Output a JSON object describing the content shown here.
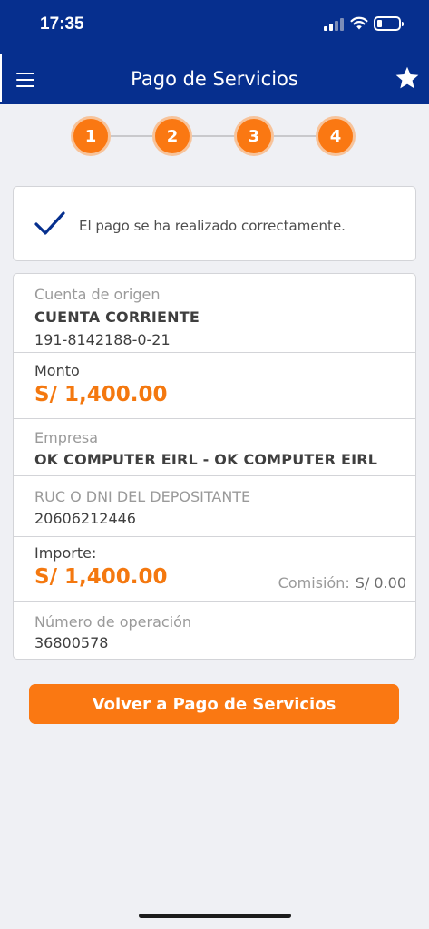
{
  "status_bar": {
    "time": "17:35"
  },
  "header": {
    "title": "Pago de Servicios"
  },
  "stepper": {
    "steps": [
      "1",
      "2",
      "3",
      "4"
    ]
  },
  "success": {
    "message": "El pago se ha realizado correctamente."
  },
  "details": {
    "origin_label": "Cuenta de origen",
    "origin_type": "CUENTA CORRIENTE",
    "origin_number": "191-8142188-0-21",
    "amount_label": "Monto",
    "amount_value": "S/ 1,400.00",
    "company_label": "Empresa",
    "company_value": "OK COMPUTER EIRL - OK COMPUTER EIRL",
    "ruc_label": "RUC O DNI DEL DEPOSITANTE",
    "ruc_value": "20606212446",
    "importe_label": "Importe:",
    "importe_value": "S/ 1,400.00",
    "comision_label": "Comisión:",
    "comision_value": "S/ 0.00",
    "operation_label": "Número de operación",
    "operation_value": "36800578"
  },
  "actions": {
    "back_label": "Volver a Pago de Servicios"
  },
  "colors": {
    "brand_blue": "#062f8e",
    "accent_orange": "#fa7812"
  }
}
